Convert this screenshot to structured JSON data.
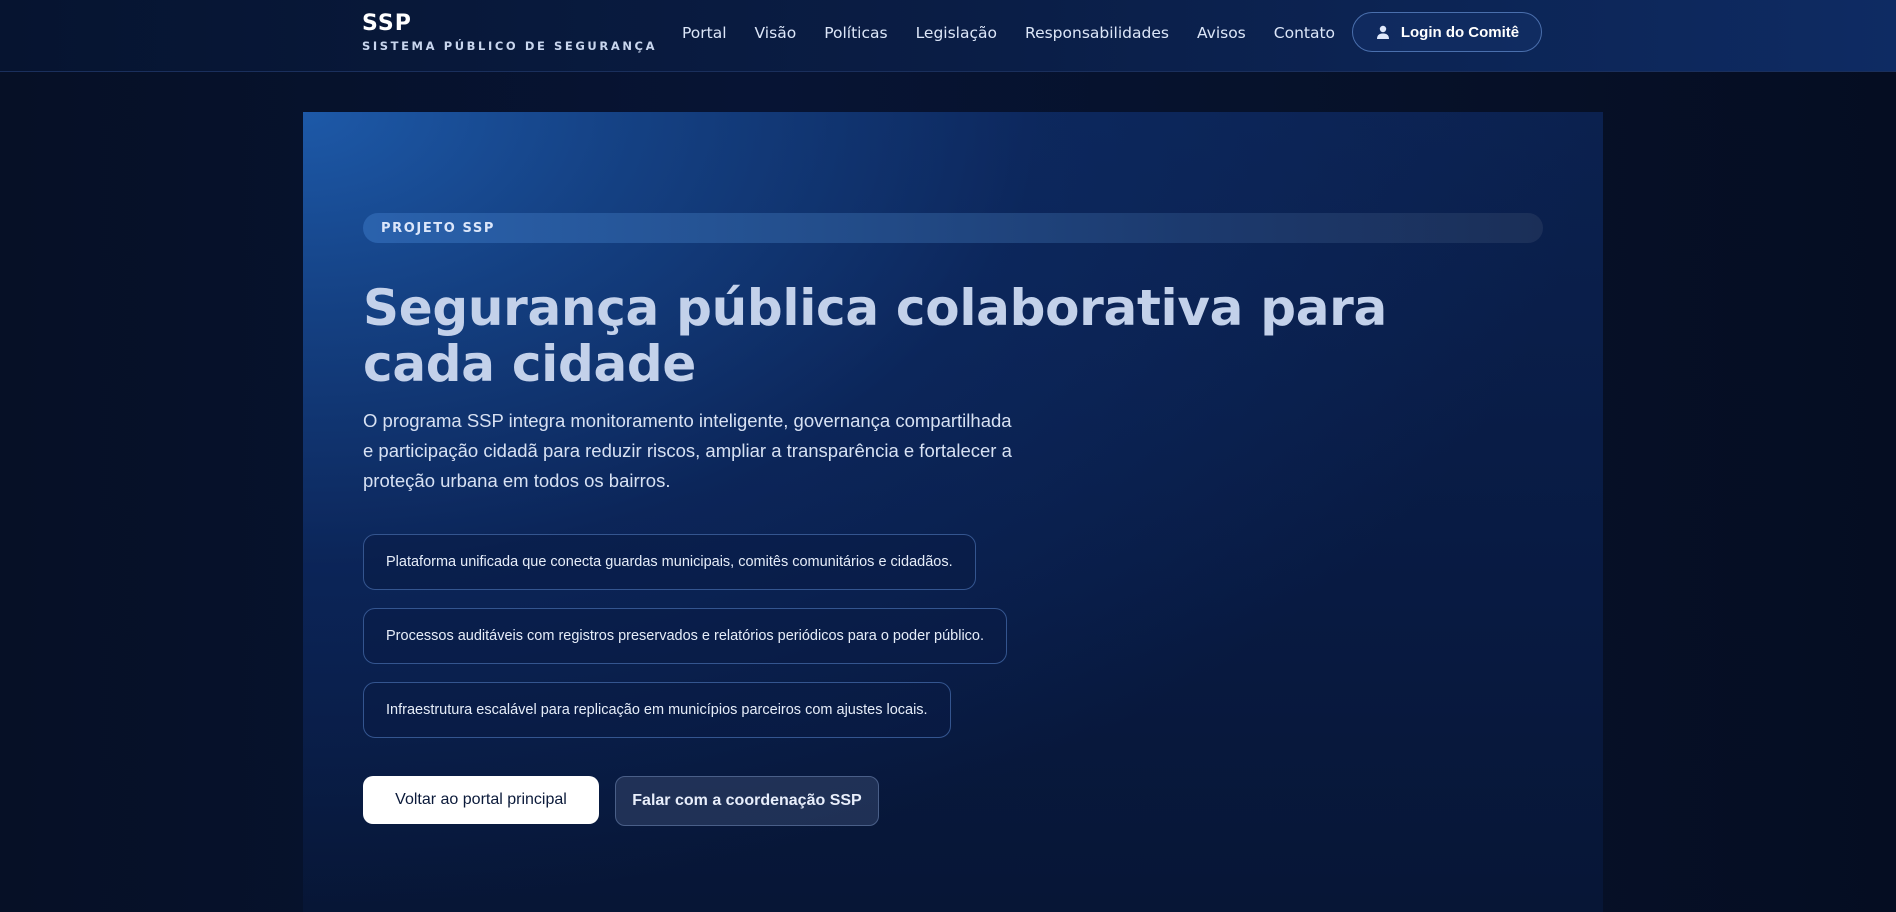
{
  "brand": {
    "title": "SSP",
    "subtitle": "SISTEMA PÚBLICO DE SEGURANÇA"
  },
  "nav": {
    "items": [
      {
        "label": "Portal"
      },
      {
        "label": "Visão"
      },
      {
        "label": "Políticas"
      },
      {
        "label": "Legislação"
      },
      {
        "label": "Responsabilidades"
      },
      {
        "label": "Avisos"
      },
      {
        "label": "Contato"
      }
    ],
    "login_label": "Login do Comitê",
    "login_icon": "user-icon"
  },
  "hero": {
    "eyebrow": "PROJETO SSP",
    "headline": "Segurança pública colaborativa para cada cidade",
    "lead": "O programa SSP integra monitoramento inteligente, governança compartilhada e participação cidadã para reduzir riscos, ampliar a transparência e fortalecer a proteção urbana em todos os bairros.",
    "features": [
      "Plataforma unificada que conecta guardas municipais, comitês comunitários e cidadãos.",
      "Processos auditáveis com registros preservados e relatórios periódicos para o poder público.",
      "Infraestrutura escalável para replicação em municípios parceiros com ajustes locais."
    ],
    "primary_cta": "Voltar ao portal principal",
    "secondary_cta": "Falar com a coordenação SSP"
  },
  "colors": {
    "background": "#07112b",
    "accent": "#1d59a8",
    "headline": "#c3d1ea"
  }
}
